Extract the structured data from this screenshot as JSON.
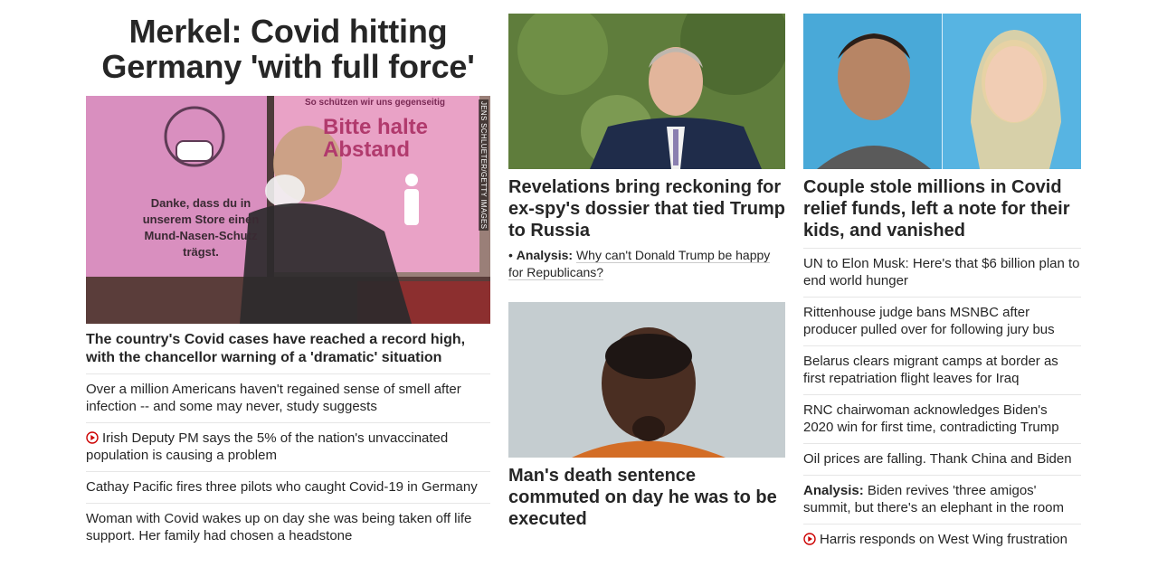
{
  "lead": {
    "headline": "Merkel: Covid hitting Germany 'with full force'",
    "image_credit": "JENS SCHLUETER/GETTY IMAGES",
    "image_sign_header": "So schützen wir uns gegenseitig",
    "image_sign_big": "Bitte halte Abstand",
    "image_sign_small": "Danke, dass du in unserem Store einen Mund-Nasen-Schutz trägst.",
    "caption": "The country's Covid cases have reached a record high, with the chancellor warning of a 'dramatic' situation",
    "items": [
      {
        "text": "Over a million Americans haven't regained sense of smell after infection -- and some may never, study suggests",
        "video": false
      },
      {
        "text": "Irish Deputy PM says the 5% of the nation's unvaccinated population is causing a problem",
        "video": true
      },
      {
        "text": "Cathay Pacific fires three pilots who caught Covid-19 in Germany",
        "video": false
      },
      {
        "text": "Woman with Covid wakes up on day she was being taken off life support. Her family had chosen a headstone",
        "video": false
      }
    ]
  },
  "middle": {
    "card1_title": "Revelations bring reckoning for ex-spy's dossier that tied Trump to Russia",
    "card1_bullet": "•",
    "card1_analysis_label": "Analysis:",
    "card1_analysis_text": "Why can't Donald Trump be happy for Republicans?",
    "card2_title": "Man's death sentence commuted on day he was to be executed"
  },
  "right": {
    "card_title": "Couple stole millions in Covid relief funds, left a note for their kids, and vanished",
    "items": [
      {
        "label": "",
        "text": "UN to Elon Musk: Here's that $6 billion plan to end world hunger",
        "video": false
      },
      {
        "label": "",
        "text": "Rittenhouse judge bans MSNBC after producer pulled over for following jury bus",
        "video": false
      },
      {
        "label": "",
        "text": "Belarus clears migrant camps at border as first repatriation flight leaves for Iraq",
        "video": false
      },
      {
        "label": "",
        "text": "RNC chairwoman acknowledges Biden's 2020 win for first time, contradicting Trump",
        "video": false
      },
      {
        "label": "",
        "text": "Oil prices are falling. Thank China and Biden",
        "video": false
      },
      {
        "label": "Analysis:",
        "text": "Biden revives 'three amigos' summit, but there's an elephant in the room",
        "video": false
      },
      {
        "label": "",
        "text": "Harris responds on West Wing frustration",
        "video": true
      }
    ]
  },
  "colors": {
    "text": "#262626",
    "divider": "#e6e6e6",
    "video_red": "#cc0000"
  },
  "icons": {
    "video": "play-circle-icon"
  }
}
